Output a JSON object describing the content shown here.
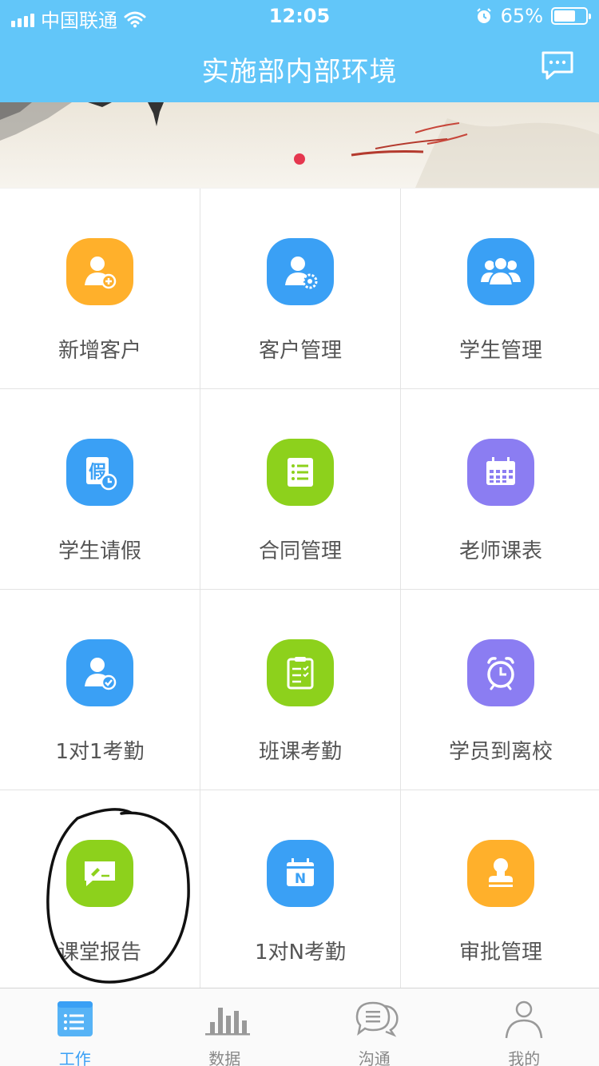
{
  "status_bar": {
    "carrier": "中国联通",
    "time": "12:05",
    "battery": "65%"
  },
  "header": {
    "title": "实施部内部环境"
  },
  "grid": {
    "items": [
      {
        "label": "新增客户",
        "icon": "add-customer-icon",
        "color": "#ffb02b"
      },
      {
        "label": "客户管理",
        "icon": "customer-settings-icon",
        "color": "#3aa0f5"
      },
      {
        "label": "学生管理",
        "icon": "students-group-icon",
        "color": "#3aa0f5"
      },
      {
        "label": "学生请假",
        "icon": "leave-request-icon",
        "color": "#3aa0f5"
      },
      {
        "label": "合同管理",
        "icon": "contract-list-icon",
        "color": "#8dd11c"
      },
      {
        "label": "老师课表",
        "icon": "calendar-icon",
        "color": "#8b7df2"
      },
      {
        "label": "1对1考勤",
        "icon": "user-check-icon",
        "color": "#3aa0f5"
      },
      {
        "label": "班课考勤",
        "icon": "clipboard-check-icon",
        "color": "#8dd11c"
      },
      {
        "label": "学员到离校",
        "icon": "alarm-clock-icon",
        "color": "#8b7df2"
      },
      {
        "label": "课堂报告",
        "icon": "report-comment-icon",
        "color": "#8dd11c"
      },
      {
        "label": "1对N考勤",
        "icon": "calendar-n-icon",
        "color": "#3aa0f5"
      },
      {
        "label": "审批管理",
        "icon": "approval-stamp-icon",
        "color": "#ffb02b"
      }
    ]
  },
  "tabs": [
    {
      "label": "工作",
      "icon": "work-list-icon",
      "active": true
    },
    {
      "label": "数据",
      "icon": "bar-chart-icon",
      "active": false
    },
    {
      "label": "沟通",
      "icon": "chat-bubbles-icon",
      "active": false
    },
    {
      "label": "我的",
      "icon": "person-icon",
      "active": false
    }
  ]
}
